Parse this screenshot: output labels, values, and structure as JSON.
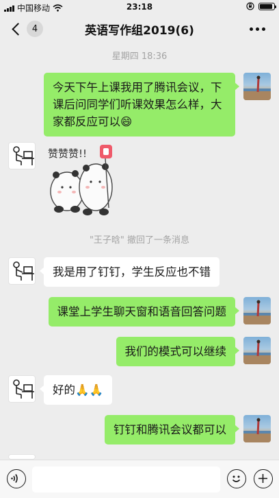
{
  "status_bar": {
    "carrier": "中国移动",
    "time": "23:18"
  },
  "nav": {
    "unread_count": "4",
    "title": "英语写作组2019(6)"
  },
  "timestamp": "星期四 18:36",
  "messages": [
    {
      "sender": "self",
      "text": "今天下午上课我用了腾讯会议，下课后问同学们听课效果怎么样，大家都反应可以😄"
    },
    {
      "sender": "other",
      "type": "sticker",
      "sticker_text": "赞赞赞!!"
    },
    {
      "sender": "self",
      "text": "课堂上学生聊天窗和语音回答问题"
    },
    {
      "sender": "self",
      "text": "我们的模式可以继续"
    },
    {
      "sender": "self",
      "text": "钉钉和腾讯会议都可以"
    }
  ],
  "other_messages": {
    "m1": "我是用了钉钉，学生反应也不错",
    "m2": "好的🙏🙏"
  },
  "system_message": "\"王子晗\" 撤回了一条消息",
  "colors": {
    "bubble_self": "#95ec69",
    "bubble_other": "#ffffff",
    "background": "#ededed"
  }
}
